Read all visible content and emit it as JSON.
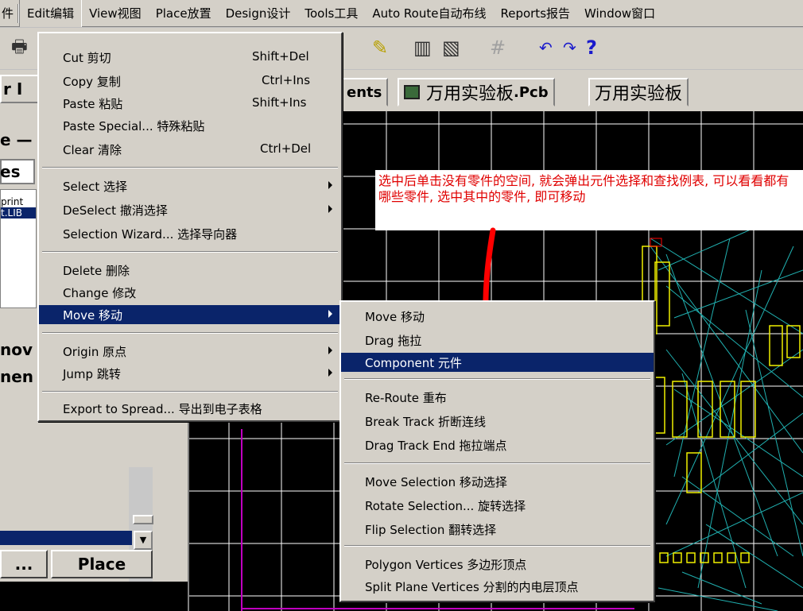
{
  "menubar": {
    "items": [
      "件",
      "Edit编辑",
      "View视图",
      "Place放置",
      "Design设计",
      "Tools工具",
      "Auto Route自动布线",
      "Reports报告",
      "Window窗口"
    ]
  },
  "toolbar": {
    "icons": [
      "printer-icon",
      "pen-icon",
      "library-icon",
      "browse-library-icon",
      "grid-icon",
      "undo-icon",
      "redo-icon",
      "help-icon"
    ],
    "glyphs": {
      "print": "🖶",
      "pen": "✎",
      "lib1": "▥",
      "lib2": "▧",
      "grid": "#",
      "undo": "↶",
      "redo": "↷",
      "help": "?"
    }
  },
  "left_panel": {
    "tab_text": "r I",
    "e_label": "e —",
    "es_label": "es",
    "list": [
      "print",
      "t.LIB"
    ],
    "mov_label": "nov",
    "nen_label": "nen",
    "scroll_down": "▼",
    "btn_dots": "...",
    "btn_place": "Place"
  },
  "doc_tabs": [
    {
      "label": "ents"
    },
    {
      "label": "万用实验板",
      "suffix": ".Pcb"
    },
    {
      "label": "万用实验板"
    }
  ],
  "annotation": {
    "text": "选中后单击没有零件的空间, 就会弹出元件选择和查找例表, 可以看看都有哪些零件, 选中其中的零件, 即可移动"
  },
  "edit_menu": {
    "items": [
      {
        "label": "Cut 剪切",
        "shortcut": "Shift+Del"
      },
      {
        "label": "Copy 复制",
        "shortcut": "Ctrl+Ins"
      },
      {
        "label": "Paste 粘贴",
        "shortcut": "Shift+Ins"
      },
      {
        "label": "Paste Special... 特殊粘贴",
        "shortcut": ""
      },
      {
        "label": "Clear 清除",
        "shortcut": "Ctrl+Del"
      },
      {
        "label": "Select 选择",
        "shortcut": ""
      },
      {
        "label": "DeSelect 撤消选择",
        "shortcut": ""
      },
      {
        "label": "Selection Wizard... 选择导向器",
        "shortcut": ""
      },
      {
        "label": "Delete 删除",
        "shortcut": ""
      },
      {
        "label": "Change 修改",
        "shortcut": ""
      },
      {
        "label": "Move 移动",
        "shortcut": ""
      },
      {
        "label": "Origin 原点",
        "shortcut": ""
      },
      {
        "label": "Jump 跳转",
        "shortcut": ""
      },
      {
        "label": "Export to Spread... 导出到电子表格",
        "shortcut": ""
      }
    ]
  },
  "move_submenu": {
    "items": [
      {
        "label": "Move 移动"
      },
      {
        "label": "Drag 拖拉"
      },
      {
        "label": "Component 元件"
      },
      {
        "label": "Re-Route 重布"
      },
      {
        "label": "Break Track 折断连线"
      },
      {
        "label": "Drag Track End 拖拉端点"
      },
      {
        "label": "Move Selection 移动选择"
      },
      {
        "label": "Rotate Selection... 旋转选择"
      },
      {
        "label": "Flip Selection 翻转选择"
      },
      {
        "label": "Polygon Vertices 多边形顶点"
      },
      {
        "label": "Split Plane Vertices 分割的内电层顶点"
      }
    ]
  },
  "colors": {
    "menu_bg": "#d4d0c8",
    "highlight": "#0a246a",
    "canvas": "#000000",
    "grid": "#ffffff",
    "ratsnest": "#20b0b0",
    "component": "#f0f000",
    "arrow": "#ff0000",
    "board_outline": "#c000c0"
  }
}
